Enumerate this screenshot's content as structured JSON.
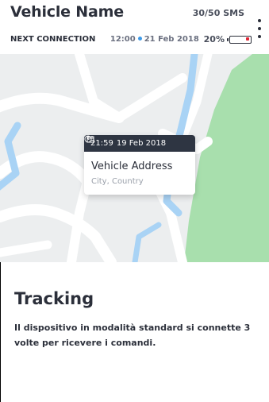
{
  "header": {
    "vehicle_name": "Vehicle Name",
    "sms_count": "30/50 SMS",
    "next_connection_label": "NEXT CONNECTION",
    "next_connection_time": "12:00",
    "next_connection_date": "21 Feb 2018",
    "battery_percent": "20%",
    "battery_level": 0.2,
    "battery_color": "#e02636"
  },
  "map": {
    "popup": {
      "time": "21:59",
      "date": "19 Feb 2018",
      "address": "Vehicle Address",
      "city": "City, Country"
    },
    "marker_color": "#e02636",
    "water_color": "#a9d3f5",
    "park_color": "#a8dfad"
  },
  "content": {
    "title": "Tracking",
    "description": "Il dispositivo in modalità standard si connette 3 volte per ricevere i comandi."
  },
  "icons": [
    "kebab-menu-icon",
    "battery-icon",
    "clock-icon",
    "calendar-icon",
    "location-pulse-icon"
  ]
}
